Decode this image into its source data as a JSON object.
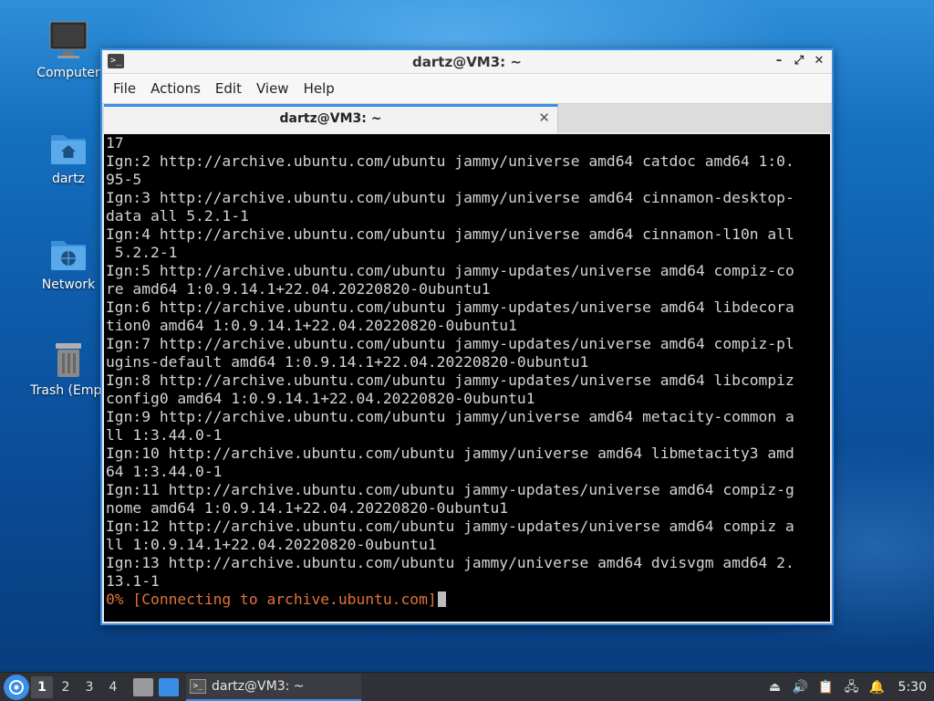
{
  "desktop": {
    "icons": [
      {
        "label": "Computer",
        "icon": "computer-icon"
      },
      {
        "label": "dartz",
        "icon": "home-folder-icon"
      },
      {
        "label": "Network",
        "icon": "network-folder-icon"
      },
      {
        "label": "Trash (Empt",
        "icon": "trash-icon"
      }
    ]
  },
  "window": {
    "title": "dartz@VM3: ~",
    "controls": {
      "minimize": "–",
      "maximize": "⤢",
      "close": "✕"
    },
    "menu": [
      "File",
      "Actions",
      "Edit",
      "View",
      "Help"
    ],
    "tab": {
      "label": "dartz@VM3: ~",
      "close": "✕"
    }
  },
  "terminal": {
    "lines": [
      "17",
      "Ign:2 http://archive.ubuntu.com/ubuntu jammy/universe amd64 catdoc amd64 1:0.",
      "95-5",
      "Ign:3 http://archive.ubuntu.com/ubuntu jammy/universe amd64 cinnamon-desktop-",
      "data all 5.2.1-1",
      "Ign:4 http://archive.ubuntu.com/ubuntu jammy/universe amd64 cinnamon-l10n all",
      " 5.2.2-1",
      "Ign:5 http://archive.ubuntu.com/ubuntu jammy-updates/universe amd64 compiz-co",
      "re amd64 1:0.9.14.1+22.04.20220820-0ubuntu1",
      "Ign:6 http://archive.ubuntu.com/ubuntu jammy-updates/universe amd64 libdecora",
      "tion0 amd64 1:0.9.14.1+22.04.20220820-0ubuntu1",
      "Ign:7 http://archive.ubuntu.com/ubuntu jammy-updates/universe amd64 compiz-pl",
      "ugins-default amd64 1:0.9.14.1+22.04.20220820-0ubuntu1",
      "Ign:8 http://archive.ubuntu.com/ubuntu jammy-updates/universe amd64 libcompiz",
      "config0 amd64 1:0.9.14.1+22.04.20220820-0ubuntu1",
      "Ign:9 http://archive.ubuntu.com/ubuntu jammy/universe amd64 metacity-common a",
      "ll 1:3.44.0-1",
      "Ign:10 http://archive.ubuntu.com/ubuntu jammy/universe amd64 libmetacity3 amd",
      "64 1:3.44.0-1",
      "Ign:11 http://archive.ubuntu.com/ubuntu jammy-updates/universe amd64 compiz-g",
      "nome amd64 1:0.9.14.1+22.04.20220820-0ubuntu1",
      "Ign:12 http://archive.ubuntu.com/ubuntu jammy-updates/universe amd64 compiz a",
      "ll 1:0.9.14.1+22.04.20220820-0ubuntu1",
      "Ign:13 http://archive.ubuntu.com/ubuntu jammy/universe amd64 dvisvgm amd64 2.",
      "13.1-1"
    ],
    "progress_line": "0% [Connecting to archive.ubuntu.com]"
  },
  "taskbar": {
    "workspaces": [
      "1",
      "2",
      "3",
      "4"
    ],
    "active_workspace": "1",
    "task": {
      "label": "dartz@VM3: ~"
    },
    "clock": "5:30"
  },
  "colors": {
    "accent": "#3a8ee6",
    "terminal_bg": "#000000",
    "terminal_fg": "#d4d4d4",
    "progress_fg": "#e0733a"
  }
}
